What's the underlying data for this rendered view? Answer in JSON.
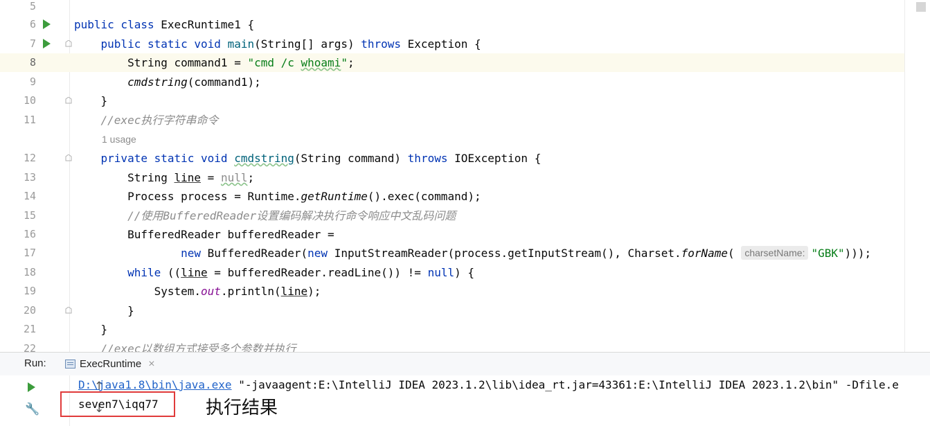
{
  "editor": {
    "lines": [
      {
        "num": "5",
        "html": ""
      },
      {
        "num": "6",
        "run": true,
        "html": "<span class=\"kw\">public class</span> ExecRuntime1 {"
      },
      {
        "num": "7",
        "run": true,
        "fold": true,
        "html": "    <span class=\"kw\">public static void</span> <span style=\"color:#00627a\">main</span>(String[] args) <span class=\"kw\">throws</span> Exception {"
      },
      {
        "num": "8",
        "current": true,
        "html": "        String command1 = <span class=\"str\">\"cmd /c <span class=\"wavy\">whoami</span>\"</span>;"
      },
      {
        "num": "9",
        "html": "        <span class=\"it\">cmdstring</span>(command1);"
      },
      {
        "num": "10",
        "fold": true,
        "html": "    }"
      },
      {
        "num": "11",
        "html": "    <span class=\"cmt\">//exec执行字符串命令</span>"
      },
      {
        "num": "",
        "usage": "1 usage"
      },
      {
        "num": "12",
        "fold": true,
        "html": "    <span class=\"kw\">private static void</span> <span class=\"wavy\" style=\"color:#00627a\">cmdstring</span>(String command) <span class=\"kw\">throws</span> IOException {"
      },
      {
        "num": "13",
        "html": "        String <span class=\"under\">line</span> = <span style=\"color:#8c8c8c\" class=\"wavy\">null</span>;"
      },
      {
        "num": "14",
        "html": "        Process process = Runtime.<span class=\"it\">getRuntime</span>().exec(command);"
      },
      {
        "num": "15",
        "html": "        <span class=\"cmt\">//使用BufferedReader设置编码解决执行命令响应中文乱码问题</span>"
      },
      {
        "num": "16",
        "html": "        BufferedReader bufferedReader ="
      },
      {
        "num": "17",
        "html": "                <span class=\"kw\">new</span> BufferedReader(<span class=\"kw\">new</span> InputStreamReader(process.getInputStream(), Charset.<span class=\"it\">forName</span>( <span class=\"hint\">charsetName:</span><span class=\"str\">\"GBK\"</span>)));"
      },
      {
        "num": "18",
        "html": "        <span class=\"kw\">while</span> ((<span class=\"under\">line</span> = bufferedReader.readLine()) != <span class=\"nul\">null</span>) {"
      },
      {
        "num": "19",
        "html": "            System.<span class=\"static-f\">out</span>.println(<span class=\"under\">line</span>);"
      },
      {
        "num": "20",
        "fold": true,
        "html": "        }"
      },
      {
        "num": "21",
        "html": "    }"
      },
      {
        "num": "22",
        "html": "    <span class=\"cmt\">//exec以数组方式接受多个参数并执行</span>"
      }
    ]
  },
  "run": {
    "label": "Run:",
    "tab_label": "ExecRuntime",
    "close": "×",
    "cmd_link": "D:\\java1.8\\bin\\java.exe",
    "cmd_rest": " \"-javaagent:E:\\IntelliJ IDEA 2023.1.2\\lib\\idea_rt.jar=43361:E:\\IntelliJ IDEA 2023.1.2\\bin\" -Dfile.e",
    "output": "seven7\\iqq77",
    "annotation": "执行结果",
    "up_arrow": "↑",
    "down_arrow": "↓",
    "wrench": "🔧"
  }
}
